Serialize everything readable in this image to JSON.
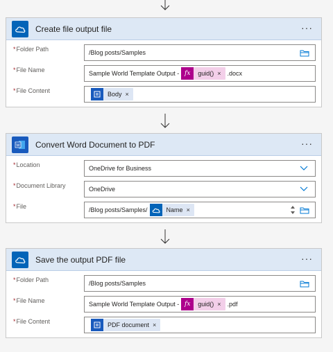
{
  "cards": [
    {
      "title": "Create file output file",
      "icon": "onedrive-icon",
      "more": "···",
      "fields": [
        {
          "label": "Folder Path",
          "value": "/Blog posts/Samples"
        },
        {
          "label": "File Name",
          "prefix": "Sample World Template Output - ",
          "token": "guid()",
          "suffix": ".docx"
        },
        {
          "label": "File Content",
          "token": "Body"
        }
      ]
    },
    {
      "title": "Convert Word Document to PDF",
      "icon": "word-icon",
      "more": "···",
      "fields": [
        {
          "label": "Location",
          "value": "OneDrive for Business"
        },
        {
          "label": "Document Library",
          "value": "OneDrive"
        },
        {
          "label": "File",
          "prefix": "/Blog posts/Samples/",
          "token": "Name"
        }
      ]
    },
    {
      "title": "Save the output PDF file",
      "icon": "onedrive-icon",
      "more": "···",
      "fields": [
        {
          "label": "Folder Path",
          "value": "/Blog posts/Samples"
        },
        {
          "label": "File Name",
          "prefix": "Sample World Template Output - ",
          "token": "guid()",
          "suffix": ".pdf"
        },
        {
          "label": "File Content",
          "token": "PDF document"
        }
      ]
    }
  ],
  "required_marker": "*",
  "token_remove": "×",
  "fx_label": "fx",
  "colors": {
    "header_bg": "#dde8f5",
    "onedrive": "#0364b8",
    "word": "#185abd",
    "expression": "#ad008c",
    "required": "#a4262c"
  }
}
